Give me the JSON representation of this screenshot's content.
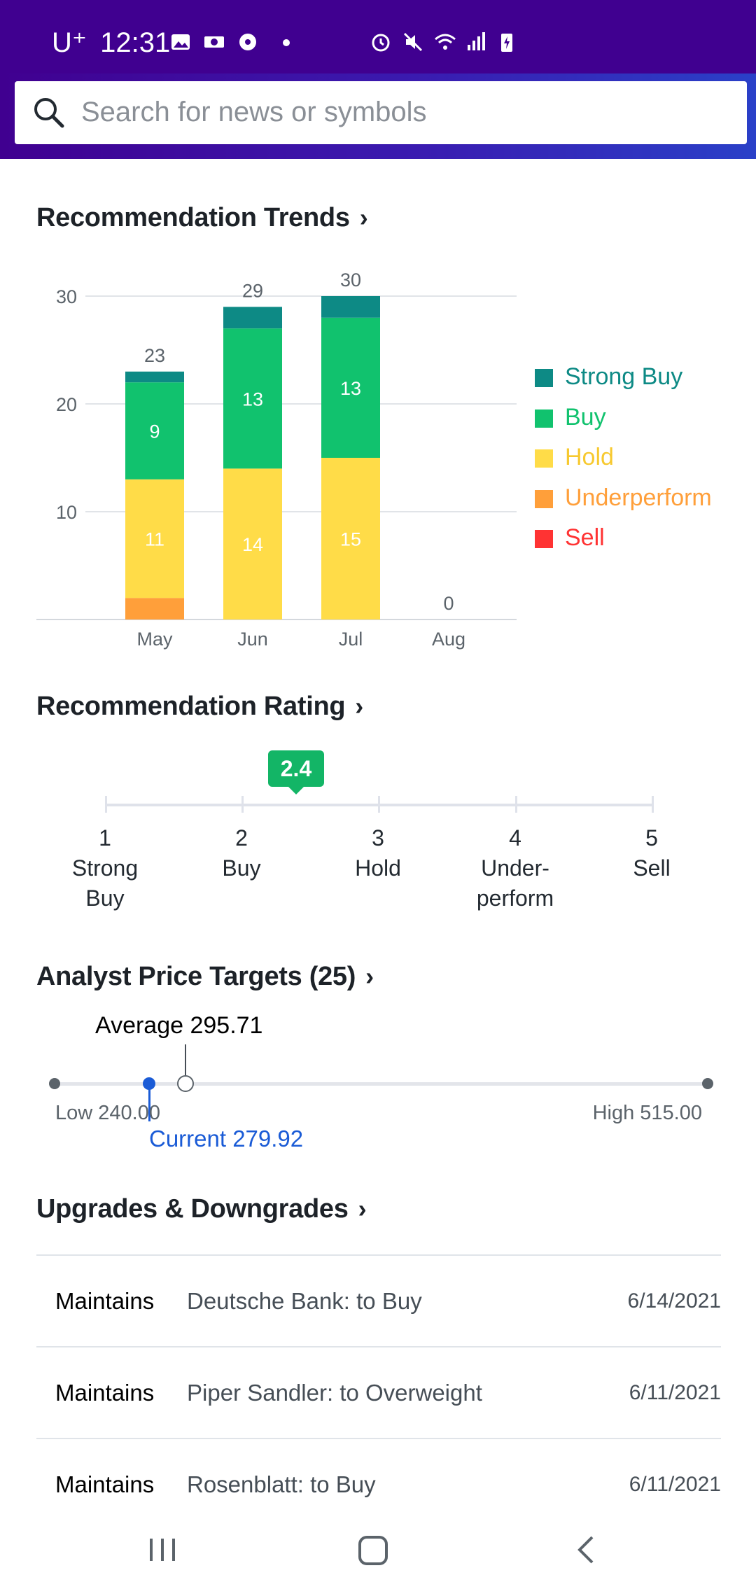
{
  "status_bar": {
    "carrier": "U⁺",
    "time": "12:31"
  },
  "search": {
    "placeholder": "Search for news or symbols"
  },
  "recommendation_trends": {
    "title": "Recommendation Trends",
    "colors": {
      "strong_buy": "#0d8a85",
      "buy": "#11c26e",
      "hold": "#ffdc48",
      "underperform": "#ff9f3a",
      "sell": "#ff3333"
    },
    "legend": [
      "Strong Buy",
      "Buy",
      "Hold",
      "Underperform",
      "Sell"
    ]
  },
  "chart_data": {
    "type": "bar",
    "stacked": true,
    "categories": [
      "May",
      "Jun",
      "Jul",
      "Aug"
    ],
    "totals": [
      23,
      29,
      30,
      0
    ],
    "series": [
      {
        "name": "Strong Buy",
        "values": [
          1,
          2,
          2,
          0
        ]
      },
      {
        "name": "Buy",
        "values": [
          9,
          13,
          13,
          0
        ]
      },
      {
        "name": "Hold",
        "values": [
          11,
          14,
          15,
          0
        ]
      },
      {
        "name": "Underperform",
        "values": [
          2,
          0,
          0,
          0
        ]
      },
      {
        "name": "Sell",
        "values": [
          0,
          0,
          0,
          0
        ]
      }
    ],
    "yticks": [
      10,
      20,
      30
    ],
    "ylim": [
      0,
      30
    ],
    "grid": true,
    "legend_position": "right"
  },
  "recommendation_rating": {
    "title": "Recommendation Rating",
    "value": "2.4",
    "scale": [
      {
        "num": "1",
        "line1": "Strong",
        "line2": "Buy"
      },
      {
        "num": "2",
        "line1": "Buy",
        "line2": ""
      },
      {
        "num": "3",
        "line1": "Hold",
        "line2": ""
      },
      {
        "num": "4",
        "line1": "Under-",
        "line2": "perform"
      },
      {
        "num": "5",
        "line1": "Sell",
        "line2": ""
      }
    ]
  },
  "price_targets": {
    "title": "Analyst Price Targets (25)",
    "average_label": "Average 295.71",
    "current_label": "Current 279.92",
    "low_label": "Low 240.00",
    "high_label": "High 515.00",
    "low": 240.0,
    "high": 515.0,
    "average": 295.71,
    "current": 279.92
  },
  "upgrades": {
    "title": "Upgrades & Downgrades",
    "rows": [
      {
        "action": "Maintains",
        "firm": "Deutsche Bank: to Buy",
        "date": "6/14/2021"
      },
      {
        "action": "Maintains",
        "firm": "Piper Sandler: to Overweight",
        "date": "6/11/2021"
      },
      {
        "action": "Maintains",
        "firm": "Rosenblatt: to Buy",
        "date": "6/11/2021"
      }
    ]
  }
}
